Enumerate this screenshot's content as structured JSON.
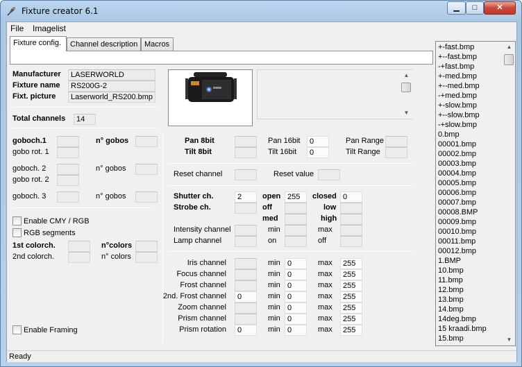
{
  "window": {
    "title": "Fixture creator 6.1",
    "min": "▁",
    "max": "□",
    "close": "✕"
  },
  "menu": [
    "File",
    "Imagelist"
  ],
  "tabs": [
    "Fixture config.",
    "Channel description",
    "Macros"
  ],
  "fixture": {
    "manufacturer_label": "Manufacturer",
    "manufacturer": "LASERWORLD",
    "name_label": "Fixture name",
    "name": "RS200G-2",
    "picture_label": "Fixt. picture",
    "picture": "Laserworld_RS200.bmp",
    "total_label": "Total channels",
    "total": "14"
  },
  "gobo": {
    "goboch1": "goboch.1",
    "n_gobos_bold": "n° gobos",
    "rot1": "gobo rot. 1",
    "goboch2": "goboch. 2",
    "n_gobos2": "n° gobos",
    "rot2": "gobo rot. 2",
    "goboch3": "goboch. 3",
    "n_gobos3": "n° gobos"
  },
  "color": {
    "enable_cmy": "Enable CMY / RGB",
    "rgb_segments": "RGB segments",
    "colorch1": "1st colorch.",
    "ncolors_bold": "n°colors",
    "colorch2": "2nd colorch.",
    "ncolors": "n° colors"
  },
  "framing": "Enable Framing",
  "pantilt": {
    "pan8": "Pan 8bit",
    "tilt8": "Tilt 8bit",
    "pan16": "Pan 16bit",
    "pan16_val": "0",
    "tilt16": "Tilt 16bit",
    "tilt16_val": "0",
    "pan_range": "Pan Range",
    "tilt_range": "Tilt Range"
  },
  "reset": {
    "channel": "Reset channel",
    "value": "Reset value"
  },
  "shutter": {
    "shutter_ch": "Shutter ch.",
    "shutter_val": "2",
    "strobe_ch": "Strobe ch.",
    "open": "open",
    "open_val": "255",
    "off": "off",
    "med": "med",
    "closed": "closed",
    "closed_val": "0",
    "low": "low",
    "high": "high",
    "intensity": "Intensity channel",
    "lamp": "Lamp channel",
    "min": "min",
    "max": "max",
    "on": "on",
    "off2": "off"
  },
  "channels": [
    {
      "label": "Iris channel",
      "ch": "",
      "min": "0",
      "max": "255"
    },
    {
      "label": "Focus channel",
      "ch": "",
      "min": "0",
      "max": "255"
    },
    {
      "label": "Frost channel",
      "ch": "",
      "min": "0",
      "max": "255"
    },
    {
      "label": "2nd. Frost channel",
      "ch": "0",
      "min": "0",
      "max": "255"
    },
    {
      "label": "Zoom channel",
      "ch": "",
      "min": "0",
      "max": "255"
    },
    {
      "label": "Prism channel",
      "ch": "",
      "min": "0",
      "max": "255"
    },
    {
      "label": "Prism rotation",
      "ch": "0",
      "min": "0",
      "max": "255"
    }
  ],
  "min_label": "min",
  "max_label": "max",
  "imagelist": [
    "+-fast.bmp",
    "+--fast.bmp",
    "-+fast.bmp",
    "+-med.bmp",
    "+--med.bmp",
    "-+med.bmp",
    "+-slow.bmp",
    "+--slow.bmp",
    "-+slow.bmp",
    "0.bmp",
    "00001.bmp",
    "00002.bmp",
    "00003.bmp",
    "00004.bmp",
    "00005.bmp",
    "00006.bmp",
    "00007.bmp",
    "00008.BMP",
    "00009.bmp",
    "00010.bmp",
    "00011.bmp",
    "00012.bmp",
    "1.BMP",
    "10.bmp",
    "11.bmp",
    "12.bmp",
    "13.bmp",
    "14.bmp",
    "14deg.bmp",
    "15 kraadi.bmp",
    "15.bmp"
  ],
  "status": "Ready"
}
